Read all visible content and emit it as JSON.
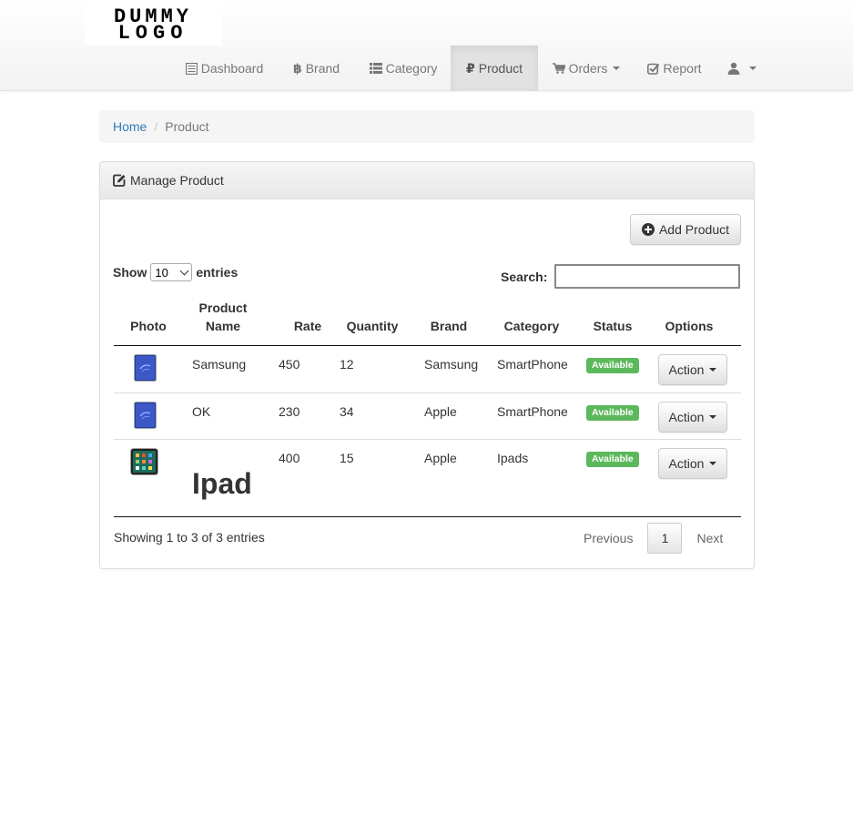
{
  "logo": {
    "text": "DUMMY LOGO"
  },
  "nav": {
    "items": [
      {
        "label": "Dashboard",
        "icon": "list-alt-icon"
      },
      {
        "label": "Brand",
        "icon": "bitcoin-icon"
      },
      {
        "label": "Category",
        "icon": "th-list-icon"
      },
      {
        "label": "Product",
        "icon": "ruble-icon",
        "active": true
      },
      {
        "label": "Orders",
        "icon": "shopping-cart-icon"
      },
      {
        "label": "Report",
        "icon": "check-icon"
      },
      {
        "label": "",
        "icon": "user-icon"
      }
    ]
  },
  "breadcrumb": {
    "home": "Home",
    "current": "Product"
  },
  "panel": {
    "title": "Manage Product",
    "add_button": "Add Product"
  },
  "datatable": {
    "show_label": "Show",
    "entries_label": "entries",
    "page_length": "10",
    "search_label": "Search:",
    "search_value": "",
    "info": "Showing 1 to 3 of 3 entries",
    "pagination": {
      "previous": "Previous",
      "current_page": "1",
      "next": "Next"
    }
  },
  "table": {
    "headers": {
      "photo": "Photo",
      "name_line1": "Product",
      "name_line2": "Name",
      "rate": "Rate",
      "quantity": "Quantity",
      "brand": "Brand",
      "category": "Category",
      "status": "Status",
      "options": "Options"
    },
    "rows": [
      {
        "name": "Samsung",
        "rate": "450",
        "quantity": "12",
        "brand": "Samsung",
        "category": "SmartPhone",
        "status": "Available",
        "action": "Action"
      },
      {
        "name": "OK",
        "rate": "230",
        "quantity": "34",
        "brand": "Apple",
        "category": "SmartPhone",
        "status": "Available",
        "action": "Action"
      },
      {
        "name": "Ipad",
        "rate": "400",
        "quantity": "15",
        "brand": "Apple",
        "category": "Ipads",
        "status": "Available",
        "action": "Action"
      }
    ]
  },
  "colors": {
    "link": "#337ab7",
    "success": "#5cb85c",
    "nav_text": "#777777"
  }
}
